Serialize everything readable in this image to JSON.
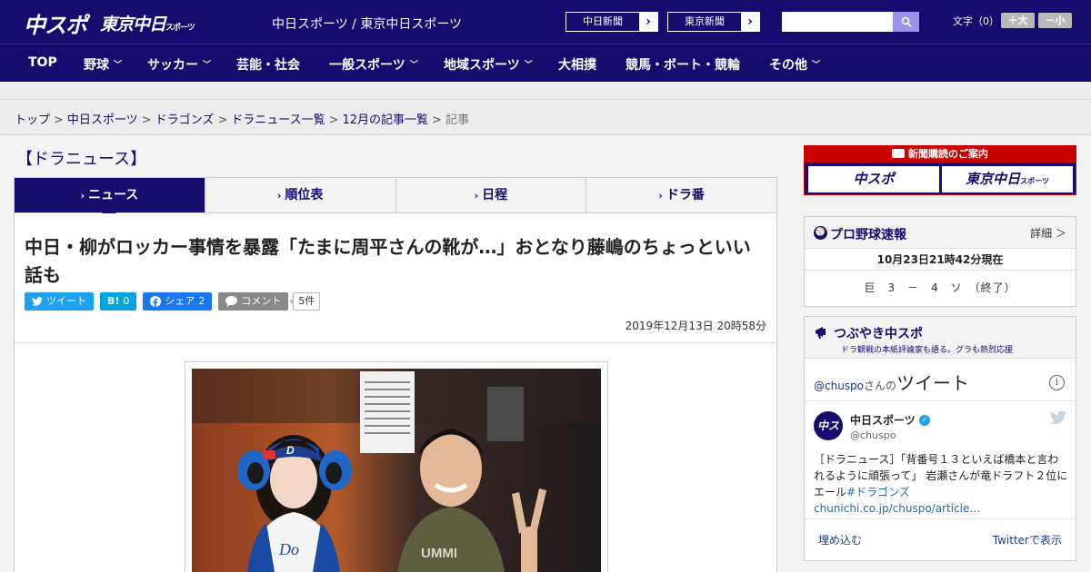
{
  "header": {
    "logo_chuspo": "中スポ",
    "logo_tokyo": "東京中日",
    "logo_tokyo_small": "スポーツ",
    "site_title": "中日スポーツ / 東京中日スポーツ",
    "paper_buttons": [
      "中日新聞",
      "東京新聞"
    ],
    "search_placeholder": "",
    "fontsize_label": "文字（0）",
    "fontsize_plus": "＋大",
    "fontsize_minus": "－小"
  },
  "nav": {
    "items": [
      {
        "label": "TOP",
        "dropdown": false
      },
      {
        "label": "野球",
        "dropdown": true
      },
      {
        "label": "サッカー",
        "dropdown": true
      },
      {
        "label": "芸能・社会",
        "dropdown": false
      },
      {
        "label": "一般スポーツ",
        "dropdown": true
      },
      {
        "label": "地域スポーツ",
        "dropdown": true
      },
      {
        "label": "大相撲",
        "dropdown": false
      },
      {
        "label": "競馬・ボート・競輪",
        "dropdown": false
      },
      {
        "label": "その他",
        "dropdown": true
      }
    ]
  },
  "breadcrumb": {
    "links": [
      "トップ",
      "中日スポーツ",
      "ドラゴンズ",
      "ドラニュース一覧",
      "12月の記事一覧"
    ],
    "current": "記事",
    "separator": ">"
  },
  "section": {
    "title": "【ドラニュース】"
  },
  "tabs": [
    {
      "label": "ニュース",
      "active": true
    },
    {
      "label": "順位表",
      "active": false
    },
    {
      "label": "日程",
      "active": false
    },
    {
      "label": "ドラ番",
      "active": false
    }
  ],
  "article": {
    "headline": "中日・柳がロッカー事情を暴露「たまに周平さんの靴が…」おとなり藤嶋のちょっといい話も",
    "share": {
      "tweet_label": "ツイート",
      "hatena_label": "B!",
      "hatena_count": "0",
      "facebook_label": "シェア",
      "facebook_count": "2",
      "comment_label": "コメント",
      "comment_count": "5件"
    },
    "published": "2019年12月13日 20時58分"
  },
  "sidebar": {
    "ad": {
      "banner": "新聞購読のご案内",
      "box1": "中スポ",
      "box2": "東京中日",
      "box2_small": "スポーツ"
    },
    "baseball": {
      "title": "プロ野球速報",
      "detail": "詳細 ＞",
      "time": "10月23日21時42分現在",
      "score": "巨　3　－　4　ソ　（終了）"
    },
    "twitter": {
      "title": "つぶやき中スポ",
      "subtitle": "ドラ観戦の本紙評論家も語る。グラも熱烈応援",
      "handle": "@chuspo",
      "handle_suffix": "さんの",
      "tweets_word": "ツイート",
      "account_name": "中日スポーツ",
      "account_handle": "@chuspo",
      "avatar_text": "中スポ",
      "tweet_text": "［ドラニュース］「背番号１３といえば橋本と言われるように頑張って」 岩瀬さんが竜ドラフト２位にエール",
      "tweet_hashtag": "#ドラゴンズ",
      "tweet_link": "chunichi.co.jp/chuspo/article…",
      "embed_label": "埋め込む",
      "view_label": "Twitterで表示"
    }
  },
  "colors": {
    "brand_navy": "#160b6e",
    "accent_red": "#c80000",
    "twitter_blue": "#1da1f2",
    "facebook_blue": "#1877f2",
    "hatena_blue": "#00a4de"
  }
}
